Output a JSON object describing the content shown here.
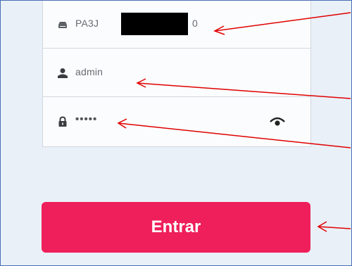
{
  "login_form": {
    "device_field": {
      "value_prefix": "PA3J",
      "value_suffix": "0",
      "icon": "router-icon"
    },
    "username_field": {
      "value": "admin",
      "icon": "user-icon"
    },
    "password_field": {
      "value": "•••••",
      "icon": "lock-icon",
      "toggle_icon": "eye-icon"
    }
  },
  "submit_button": {
    "label": "Entrar",
    "color": "#ef1f5b"
  },
  "annotation": {
    "arrow_color": "#e00000"
  }
}
